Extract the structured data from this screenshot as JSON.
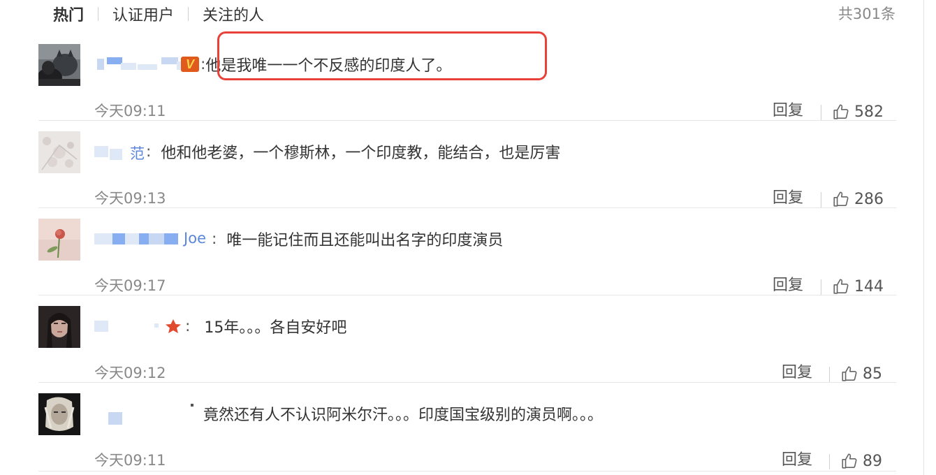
{
  "tabs": [
    {
      "label": "热门",
      "active": true
    },
    {
      "label": "认证用户",
      "active": false
    },
    {
      "label": "关注的人",
      "active": false
    }
  ],
  "total_count": "共301条",
  "reply_label": "回复",
  "comments": [
    {
      "username": "",
      "badge": "V",
      "text": "他是我唯一一个不反感的印度人了。",
      "time": "今天09:11",
      "likes": "582"
    },
    {
      "username": "范",
      "text": "他和他老婆，一个穆斯林，一个印度教，能结合，也是厉害",
      "time": "今天09:13",
      "likes": "286"
    },
    {
      "username": "Joe",
      "text": "唯一能记住而且还能叫出名字的印度演员",
      "time": "今天09:17",
      "likes": "144"
    },
    {
      "username": "",
      "text": "15年。。。各自安好吧",
      "time": "今天09:12",
      "likes": "85"
    },
    {
      "username": "",
      "text": "竟然还有人不认识阿米尔汗。。。印度国宝级别的演员啊。。。",
      "time": "今天09:11",
      "likes": "89"
    }
  ],
  "colors": {
    "username_blue": "#5b86d9",
    "highlight_red": "#e8413a",
    "badge_orange": "#e05a1b",
    "time_gray": "#888888"
  }
}
